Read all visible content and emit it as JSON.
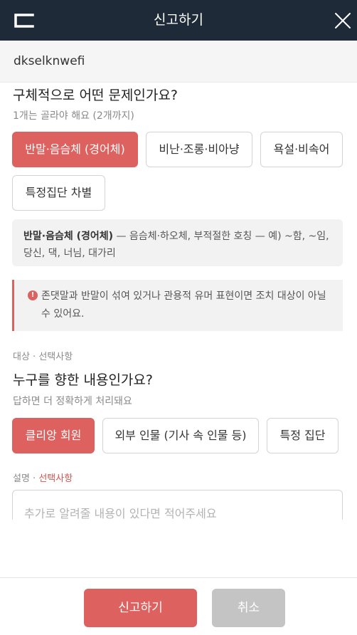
{
  "header": {
    "title": "신고하기",
    "logo_icon": "logo-bracket-icon",
    "close_icon": "close-icon",
    "bg_color": "#1e2a38"
  },
  "subject": {
    "text": "dkselknwefi"
  },
  "problem": {
    "title": "구체적으로 어떤 문제인가요?",
    "subtitle": "1개는 골라야 해요 (2개까지)",
    "options": [
      {
        "label": "반말·음슴체 (경어체)",
        "selected": true
      },
      {
        "label": "비난·조롱·비아냥",
        "selected": false
      },
      {
        "label": "욕설·비속어",
        "selected": false
      },
      {
        "label": "특정집단 차별",
        "selected": false
      }
    ],
    "description_term": "반말·음슴체 (경어체)",
    "description_text": " — 음슴체·하오체, 부적절한 호칭 — 예) ~함, ~임, 당신, 댁, 너님, 대가리",
    "warning_icon": "info-icon",
    "warning_text": "존댓말과 반말이 섞여 있거나 관용적 유머 표현이면 조치 대상이 아닐 수 있어요."
  },
  "target": {
    "section_label": "대상 · 선택사항",
    "title": "누구를 향한 내용인가요?",
    "subtitle": "답하면 더 정확하게 처리돼요",
    "options": [
      {
        "label": "클리앙 회원",
        "selected": true
      },
      {
        "label": "외부 인물 (기사 속 인물 등)",
        "selected": false
      },
      {
        "label": "특정 집단",
        "selected": false
      }
    ]
  },
  "explanation": {
    "label_prefix": "설명 · ",
    "label_optional": "선택사항",
    "placeholder": "추가로 알려줄 내용이 있다면 적어주세요"
  },
  "footer": {
    "submit_label": "신고하기",
    "cancel_label": "취소"
  },
  "colors": {
    "accent": "#dd615e",
    "cancel": "#c4c4c4"
  }
}
